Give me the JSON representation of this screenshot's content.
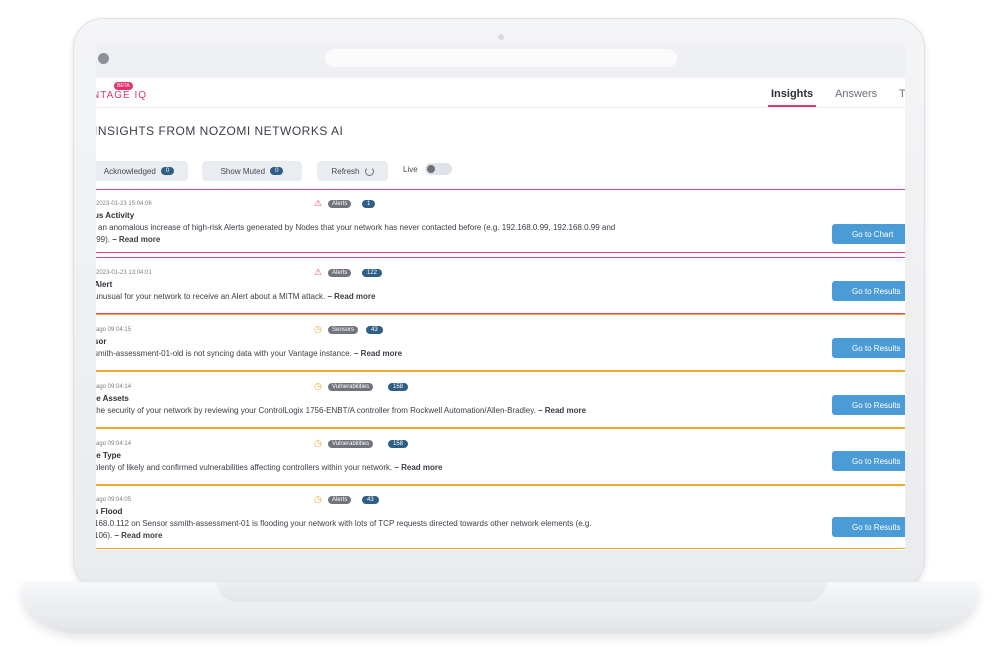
{
  "app": {
    "logo_text": "NTAGE IQ",
    "logo_badge": "BETA"
  },
  "nav": {
    "tabs": [
      {
        "label": "Insights"
      },
      {
        "label": "Answers"
      },
      {
        "label": "T"
      }
    ]
  },
  "page": {
    "title": "INSIGHTS FROM NOZOMI NETWORKS AI"
  },
  "toolbar": {
    "acknowledged_label": "Acknowledged",
    "acknowledged_count": "0",
    "muted_label": "Show Muted",
    "muted_count": "0",
    "refresh_label": "Refresh",
    "live_label": "Live"
  },
  "colors": {
    "accent": "#e5336f",
    "critical": "#e8436e",
    "warning": "#f0a92b",
    "action": "#4b9cd6",
    "count": "#2e5f86"
  },
  "insights": [
    {
      "meta": "2023-01-23 15:04:06",
      "severity_icon": "warning-triangle-icon",
      "tag": "Alerts",
      "count": "1",
      "title": "us Activity",
      "desc": "l an anomalous increase of high-risk Alerts generated by Nodes that your network has never contacted before (e.g. 192.168.0.99, 192.168.0.99 and",
      "desc2": ".99).",
      "read_more": "– Read more",
      "action": "Go to Chart"
    },
    {
      "meta": "2023-01-23 13:04:01",
      "severity_icon": "warning-triangle-icon",
      "tag": "Alerts",
      "count": "122",
      "title": "Alert",
      "desc": "unusual for your network to receive an Alert about a MITM attack.",
      "read_more": "– Read more",
      "action": "Go to Results"
    },
    {
      "meta": "ago   09:04:15",
      "severity_icon": "clock-icon",
      "tag": "Sensors",
      "count": "43",
      "title": "sor",
      "desc": "smith-assessment-01-old is not syncing data with your Vantage instance.",
      "read_more": "– Read more",
      "action": "Go to Results"
    },
    {
      "meta": "ago   09:04:14",
      "severity_icon": "clock-icon",
      "tag": "Vulnerabilities",
      "count": "158",
      "title": "le Assets",
      "desc": "the security of your network by reviewing your ControlLogix 1756-ENBT/A controller from Rockwell Automation/Allen-Bradley.",
      "read_more": "– Read more",
      "action": "Go to Results"
    },
    {
      "meta": "ago   09:04:14",
      "severity_icon": "clock-icon",
      "tag": "Vulnerabilities",
      "count": "158",
      "title": "le Type",
      "desc": "plenty of likely and confirmed vulnerabilities affecting controllers within your network.",
      "read_more": "– Read more",
      "action": "Go to Results"
    },
    {
      "meta": "ago   09:04:05",
      "severity_icon": "clock-icon",
      "tag": "Alerts",
      "count": "43",
      "title": "s Flood",
      "desc": "168.0.112 on Sensor ssmith-assessment-01 is flooding your network with lots of TCP requests directed towards other network elements (e.g.",
      "desc2": "106).",
      "read_more": "– Read more",
      "action": "Go to Results"
    }
  ]
}
